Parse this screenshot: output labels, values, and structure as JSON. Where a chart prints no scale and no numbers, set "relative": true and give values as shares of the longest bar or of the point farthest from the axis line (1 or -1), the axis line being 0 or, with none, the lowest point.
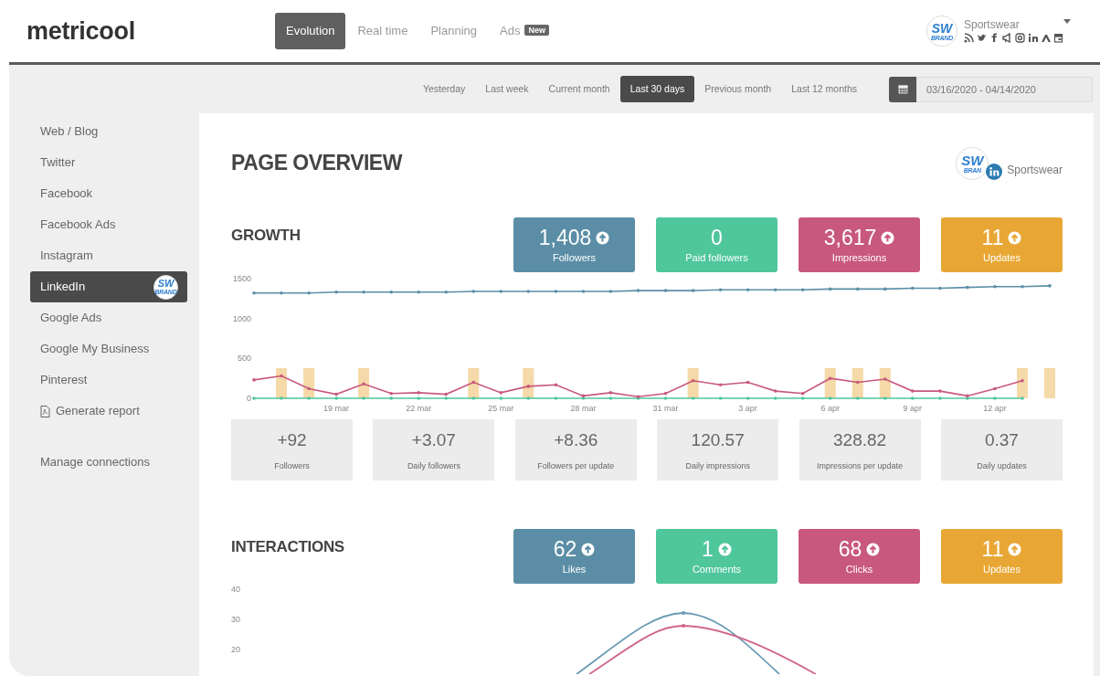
{
  "header": {
    "logo": "metricool",
    "nav": [
      {
        "label": "Evolution",
        "selected": true
      },
      {
        "label": "Real time",
        "selected": false
      },
      {
        "label": "Planning",
        "selected": false
      },
      {
        "label": "Ads",
        "selected": false,
        "badge": "New"
      }
    ],
    "account": {
      "name": "Sportswear",
      "avatar_top": "SW",
      "avatar_bottom": "BRAND"
    }
  },
  "periods": [
    {
      "label": "Yesterday",
      "selected": false
    },
    {
      "label": "Last week",
      "selected": false
    },
    {
      "label": "Current month",
      "selected": false
    },
    {
      "label": "Last 30 days",
      "selected": true
    },
    {
      "label": "Previous month",
      "selected": false
    },
    {
      "label": "Last 12 months",
      "selected": false
    }
  ],
  "date_range": "03/16/2020 - 04/14/2020",
  "sidebar": {
    "items": [
      {
        "label": "Web / Blog",
        "selected": false
      },
      {
        "label": "Twitter",
        "selected": false
      },
      {
        "label": "Facebook",
        "selected": false
      },
      {
        "label": "Facebook Ads",
        "selected": false
      },
      {
        "label": "Instagram",
        "selected": false
      },
      {
        "label": "LinkedIn",
        "selected": true,
        "avatar_top": "SW",
        "avatar_bottom": "BRAND"
      },
      {
        "label": "Google Ads",
        "selected": false
      },
      {
        "label": "Google My Business",
        "selected": false
      },
      {
        "label": "Pinterest",
        "selected": false
      },
      {
        "label": "Generate report",
        "selected": false,
        "kind": "report"
      }
    ],
    "manage": "Manage connections"
  },
  "page": {
    "title": "PAGE OVERVIEW",
    "brand": {
      "top": "SW",
      "bottom": "BRAN",
      "name": "Sportswear"
    }
  },
  "growth": {
    "title": "GROWTH",
    "stats": [
      {
        "value": "1,408",
        "label": "Followers",
        "color": "#5b8ea6",
        "trend_up": true
      },
      {
        "value": "0",
        "label": "Paid followers",
        "color": "#4fc69c",
        "trend_up": false
      },
      {
        "value": "3,617",
        "label": "Impressions",
        "color": "#c8587d",
        "trend_up": true
      },
      {
        "value": "11",
        "label": "Updates",
        "color": "#e8a735",
        "trend_up": true
      }
    ],
    "chart_data": {
      "type": "line",
      "categories": [
        null,
        null,
        null,
        "19 mar",
        null,
        null,
        "22 mar",
        null,
        null,
        "25 mar",
        null,
        null,
        "28 mar",
        null,
        null,
        "31 mar",
        null,
        null,
        "3 apr",
        null,
        null,
        "6 apr",
        null,
        null,
        "9 apr",
        null,
        null,
        "12 apr",
        null,
        null
      ],
      "ylim": [
        0,
        1500
      ],
      "yticks": [
        0,
        500,
        1000,
        1500
      ],
      "series": [
        {
          "color": "#5b8ea6",
          "values": [
            1320,
            1320,
            1320,
            1330,
            1330,
            1330,
            1330,
            1330,
            1340,
            1340,
            1340,
            1340,
            1340,
            1340,
            1350,
            1350,
            1350,
            1360,
            1360,
            1360,
            1360,
            1370,
            1370,
            1370,
            1380,
            1380,
            1390,
            1400,
            1400,
            1410
          ]
        },
        {
          "color": "#4fc69c",
          "values": [
            0,
            0,
            0,
            0,
            0,
            0,
            0,
            0,
            0,
            0,
            0,
            0,
            0,
            0,
            0,
            0,
            0,
            0,
            0,
            0,
            0,
            0,
            0,
            0,
            0,
            0,
            0,
            0,
            0,
            null
          ]
        },
        {
          "color": "#c8587d",
          "values": [
            230,
            280,
            120,
            50,
            180,
            60,
            70,
            50,
            200,
            70,
            150,
            170,
            30,
            70,
            20,
            60,
            220,
            170,
            200,
            90,
            60,
            250,
            200,
            240,
            90,
            90,
            30,
            120,
            220,
            null
          ]
        }
      ]
    },
    "updates": {
      "chart_data": {
        "type": "bar",
        "relative": true,
        "categories": [
          null,
          null,
          null,
          null,
          null,
          null,
          null,
          null,
          null,
          null,
          null,
          null,
          null,
          null,
          null,
          null,
          null,
          null,
          null,
          null,
          null,
          null,
          null,
          null,
          null,
          null,
          null,
          null,
          null,
          null
        ],
        "series": [
          {
            "color": "#f5d9a8",
            "values": [
              0,
              1,
              1,
              0,
              1,
              0,
              0,
              0,
              1,
              0,
              1,
              0,
              0,
              0,
              0,
              0,
              1,
              0,
              0,
              0,
              0,
              1,
              1,
              1,
              0,
              0,
              0,
              0,
              1,
              1
            ]
          }
        ]
      }
    },
    "metrics": [
      {
        "value": "+92",
        "label": "Followers"
      },
      {
        "value": "+3.07",
        "label": "Daily followers"
      },
      {
        "value": "+8.36",
        "label": "Followers per update"
      },
      {
        "value": "120.57",
        "label": "Daily impressions"
      },
      {
        "value": "328.82",
        "label": "Impressions per update"
      },
      {
        "value": "0.37",
        "label": "Daily updates"
      }
    ]
  },
  "interactions": {
    "title": "INTERACTIONS",
    "stats": [
      {
        "value": "62",
        "label": "Likes",
        "color": "#5b8ea6",
        "trend_up": true
      },
      {
        "value": "1",
        "label": "Comments",
        "color": "#4fc69c",
        "trend_up": true
      },
      {
        "value": "68",
        "label": "Clicks",
        "color": "#c8587d",
        "trend_up": true
      },
      {
        "value": "11",
        "label": "Updates",
        "color": "#e8a735",
        "trend_up": true
      }
    ],
    "axis_labels": [
      "40",
      "30",
      "20"
    ]
  }
}
